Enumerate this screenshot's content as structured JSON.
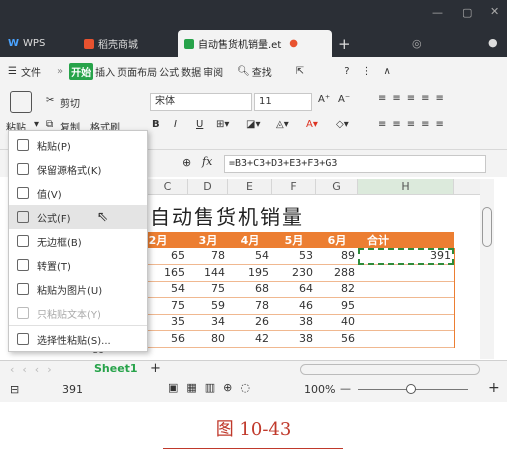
{
  "titlebar": {
    "tabs": [
      {
        "label": "WPS"
      },
      {
        "label": "稻壳商城"
      },
      {
        "label": "自动售货机销量.et"
      }
    ],
    "new_tab": "+"
  },
  "menubar": {
    "items": [
      "文件",
      "开始",
      "插入",
      "页面布局",
      "公式",
      "数据",
      "审阅"
    ],
    "search": "查找"
  },
  "ribbon": {
    "paste": "粘贴",
    "cut": "剪切",
    "copy": "复制",
    "format_painter": "格式刷",
    "font_name": "宋体",
    "font_size": "11",
    "bold": "B",
    "italic": "I",
    "underline": "U",
    "grow": "A⁺",
    "shrink": "A⁻"
  },
  "formula_bar": {
    "fx": "fx",
    "formula": "=B3+C3+D3+E3+F3+G3"
  },
  "grid": {
    "columns": [
      "C",
      "D",
      "E",
      "F",
      "G",
      "H"
    ],
    "title": "自动售货机销量",
    "headers": [
      "2月",
      "3月",
      "4月",
      "5月",
      "6月",
      "合计"
    ],
    "rows": [
      [
        "65",
        "78",
        "54",
        "53",
        "89",
        "391"
      ],
      [
        "165",
        "144",
        "195",
        "230",
        "288",
        ""
      ],
      [
        "54",
        "75",
        "68",
        "64",
        "82",
        ""
      ],
      [
        "75",
        "59",
        "78",
        "46",
        "95",
        ""
      ],
      [
        "35",
        "34",
        "26",
        "38",
        "40",
        ""
      ],
      [
        "56",
        "80",
        "42",
        "38",
        "56",
        ""
      ]
    ],
    "partial_b9": "89"
  },
  "paste_menu": {
    "items": [
      {
        "label": "粘贴(P)",
        "state": "normal"
      },
      {
        "label": "保留源格式(K)",
        "state": "normal"
      },
      {
        "label": "值(V)",
        "state": "normal"
      },
      {
        "label": "公式(F)",
        "state": "hover"
      },
      {
        "label": "无边框(B)",
        "state": "normal"
      },
      {
        "label": "转置(T)",
        "state": "normal"
      },
      {
        "label": "粘贴为图片(U)",
        "state": "normal"
      },
      {
        "label": "只粘贴文本(Y)",
        "state": "disabled"
      },
      {
        "label": "选择性粘贴(S)...",
        "state": "normal"
      }
    ]
  },
  "sheetbar": {
    "sheet": "Sheet1",
    "add": "+"
  },
  "statusbar": {
    "sum": "391",
    "zoom": "100%"
  },
  "caption": "图 10-43",
  "colors": {
    "accent_orange": "#ec7e32",
    "wps_green": "#27a34a",
    "title_dark": "#2b2f36",
    "caption_red": "#c0392b"
  }
}
